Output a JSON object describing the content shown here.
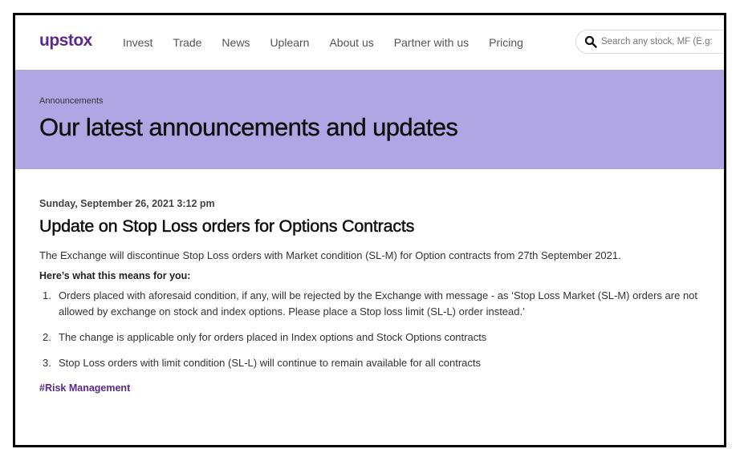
{
  "nav": {
    "logo": "upstox",
    "links": [
      "Invest",
      "Trade",
      "News",
      "Uplearn",
      "About us",
      "Partner with us",
      "Pricing"
    ],
    "search_placeholder": "Search any stock, MF (E.g:",
    "search_icon": "search-icon"
  },
  "hero": {
    "breadcrumb": "Announcements",
    "title": "Our latest announcements and updates"
  },
  "post": {
    "date": "Sunday, September 26, 2021 3:12 pm",
    "title": "Update on Stop Loss orders for Options Contracts",
    "intro": "The Exchange will discontinue Stop Loss orders with Market condition (SL-M) for Option contracts from 27th September 2021.",
    "subhead": "Here’s what this means for you:",
    "points": [
      {
        "num": "1.",
        "text": "Orders placed with aforesaid condition, if any, will be rejected by the Exchange with message - as ‘Stop Loss Market (SL-M) orders are not allowed by exchange on stock and index options. Please place a Stop loss limit (SL-L) order instead.’"
      },
      {
        "num": "2.",
        "text": "The change is applicable only for orders placed in Index options and Stock Options contracts"
      },
      {
        "num": "3.",
        "text": "Stop Loss orders with limit condition (SL-L) will continue to remain available for all contracts"
      }
    ],
    "tag": "#Risk Management"
  },
  "colors": {
    "brand": "#5a298b",
    "hero_bg": "#b0a6e3"
  }
}
